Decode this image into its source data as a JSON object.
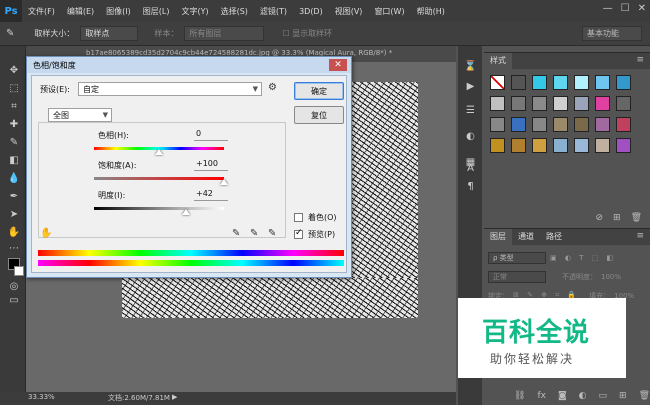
{
  "app": {
    "logo": "Ps",
    "menu": [
      "文件(F)",
      "编辑(E)",
      "图像(I)",
      "图层(L)",
      "文字(Y)",
      "选择(S)",
      "滤镜(T)",
      "3D(D)",
      "视图(V)",
      "窗口(W)",
      "帮助(H)"
    ],
    "window_controls": [
      "—",
      "☐",
      "✕"
    ]
  },
  "options_bar": {
    "sample_size_label": "取样大小：",
    "sample_size_value": "取样点",
    "sample_label": "样本：",
    "sample_value": "所有图层",
    "show_ring_label": "显示取样环",
    "workspace": "基本功能"
  },
  "document": {
    "tab_title": "b17ae8065389cd35d2704c9cb44e724588281dc.jpg @ 33.3% (Magical Aura, RGB/8*) *",
    "zoom": "33.33%",
    "doc_info": "文档:2.60M/7.81M"
  },
  "styles_panel": {
    "tab": "样式",
    "swatches": [
      "#ffffff",
      "#555555",
      "#33c7e8",
      "#5fd6f0",
      "#b0f0ff",
      "#6ec6f0",
      "#3399cc",
      "#c0c0c0",
      "#777777",
      "#8a8a8a",
      "#cfcfcf",
      "#9aa3b8",
      "#e040a0",
      "#666666",
      "#888888",
      "#3a70c0",
      "#888888",
      "#9a8a6a",
      "#7a6a4a",
      "#a06aa0",
      "#c04060",
      "#c09020",
      "#b08030",
      "#d0a040",
      "#8ab0d0",
      "#9ab8d8",
      "#c0b0a0",
      "#a050c0"
    ]
  },
  "layers_panel": {
    "tabs": [
      "图层",
      "通道",
      "路径"
    ],
    "kind_label": "ρ 类型",
    "blend_mode": "正常",
    "opacity_label": "不透明度：",
    "opacity_value": "100%",
    "lock_label": "锁定：",
    "fill_label": "填充：",
    "fill_value": "100%"
  },
  "dialog": {
    "title": "色相/饱和度",
    "close": "✕",
    "preset_label": "预设(E):",
    "preset_value": "自定",
    "channel_value": "全图",
    "hue_label": "色相(H):",
    "hue_value": "0",
    "saturation_label": "饱和度(A):",
    "saturation_value": "+100",
    "lightness_label": "明度(I):",
    "lightness_value": "+42",
    "ok_label": "确定",
    "reset_label": "复位",
    "colorize_label": "着色(O)",
    "colorize_checked": false,
    "preview_label": "预览(P)",
    "preview_checked": true,
    "hue_level": 0.5,
    "saturation_level": 1.0,
    "lightness_level": 0.71
  },
  "watermark": {
    "title": "百科全说",
    "subtitle": "助你轻松解决"
  }
}
